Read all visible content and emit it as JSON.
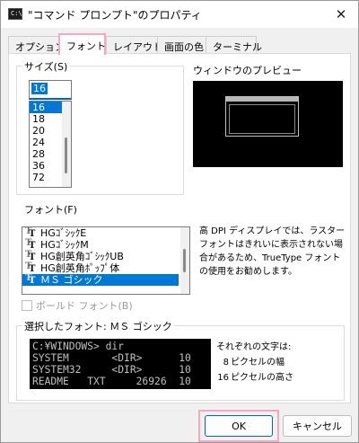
{
  "window": {
    "title": "\"コマンド プロンプト\"のプロパティ",
    "app_icon_text": "C:\\",
    "close_glyph": "✕"
  },
  "tabs": [
    {
      "label": "オプション",
      "active": false
    },
    {
      "label": "フォント",
      "active": true
    },
    {
      "label": "レイアウト",
      "active": false
    },
    {
      "label": "画面の色",
      "active": false
    },
    {
      "label": "ターミナル",
      "active": false
    }
  ],
  "size_group": {
    "label": "サイズ(S)",
    "input_value": "16",
    "items": [
      "16",
      "18",
      "20",
      "24",
      "28",
      "36",
      "72"
    ],
    "selected": "16"
  },
  "preview": {
    "label": "ウィンドウのプレビュー"
  },
  "font_group": {
    "label": "フォント(F)",
    "items": [
      "HGｺﾞｼｯｸE",
      "HGｺﾞｼｯｸM",
      "HG創英角ｺﾞｼｯｸUB",
      "HG創英角ﾎﾟｯﾌﾟ体",
      "ＭＳ ゴシック"
    ],
    "selected": "ＭＳ ゴシック",
    "bold_label": "ボールド フォント(B)",
    "bold_checked": false,
    "description": "高 DPI ディスプレイでは、ラスター フォントはきれいに表示されない場合があるため、TrueType フォントの使用をお勧めします。"
  },
  "selected_font": {
    "label": "選択したフォント: ＭＳ ゴシック",
    "console_lines": [
      "C:¥WINDOWS> dir",
      "SYSTEM       <DIR>      10",
      "SYSTEM32     <DIR>      10",
      "README   TXT     26926  10"
    ],
    "info_title": "それぞれの文字は:",
    "width_value": "8",
    "width_label": "ピクセルの幅",
    "height_value": "16",
    "height_label": "ピクセルの高さ"
  },
  "buttons": {
    "ok": "OK",
    "cancel": "キャンセル"
  },
  "colors": {
    "accent": "#0078d7",
    "highlight_ring": "#f2a9c4"
  },
  "icons": {
    "app": "console-icon",
    "close": "close-icon",
    "font_type": "truetype-icon"
  }
}
